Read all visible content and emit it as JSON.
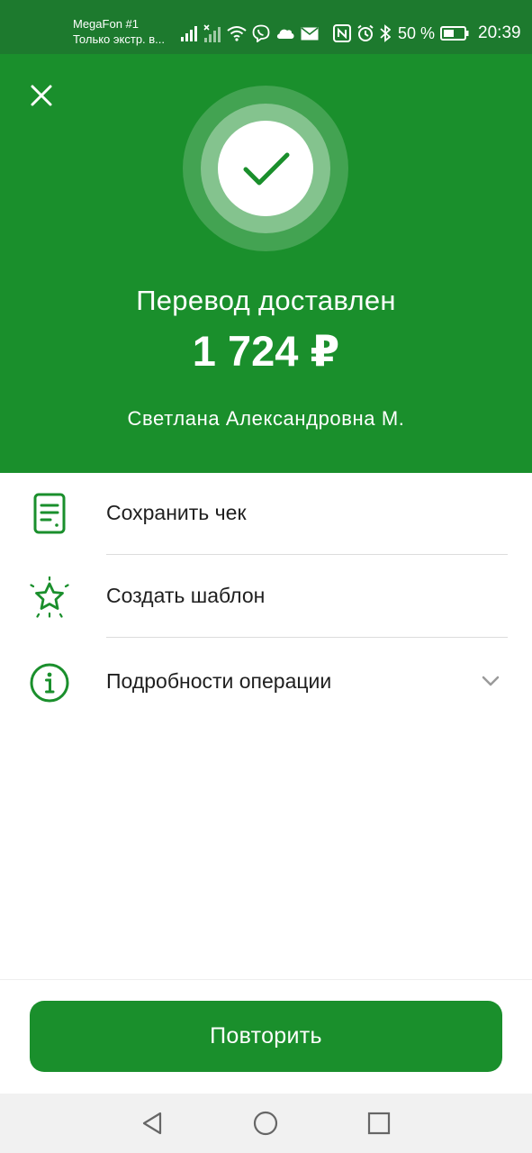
{
  "status_bar": {
    "carrier_line1": "MegaFon #1",
    "carrier_line2": "Только экстр. в...",
    "battery_percent": "50 %",
    "time": "20:39",
    "icons": [
      "signal-icon",
      "signal-no-service-icon",
      "wifi-icon",
      "viber-icon",
      "cloud-icon",
      "mail-icon",
      "nfc-icon",
      "alarm-icon",
      "bluetooth-icon",
      "battery-icon"
    ]
  },
  "header": {
    "status_title": "Перевод доставлен",
    "amount": "1 724 ₽",
    "recipient": "Светлана Александровна М."
  },
  "actions": [
    {
      "label": "Сохранить чек",
      "icon": "receipt-icon"
    },
    {
      "label": "Создать шаблон",
      "icon": "star-icon"
    },
    {
      "label": "Подробности операции",
      "icon": "info-icon"
    }
  ],
  "repeat_button": {
    "label": "Повторить"
  },
  "colors": {
    "brand_green": "#1a8f2c",
    "status_bar": "#1d7a2e",
    "text": "#1f1f1f",
    "divider": "#dcdcdc"
  }
}
